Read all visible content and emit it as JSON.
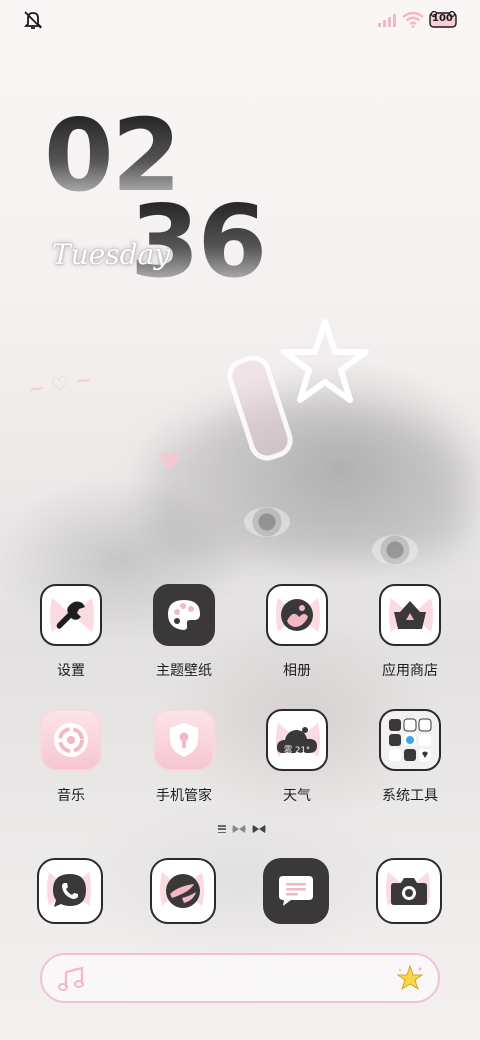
{
  "status_bar": {
    "left_icon": "mute-bell-icon",
    "signal_icon": "signal-bars-icon",
    "wifi_icon": "wifi-icon",
    "battery_level": "100",
    "accent_color": "#f2b8c6"
  },
  "clock": {
    "hour": "02",
    "minute": "36",
    "day": "Tuesday"
  },
  "apps": [
    {
      "label": "设置",
      "icon": "wrench-icon"
    },
    {
      "label": "主题壁纸",
      "icon": "palette-icon"
    },
    {
      "label": "相册",
      "icon": "photo-album-icon"
    },
    {
      "label": "应用商店",
      "icon": "shopping-basket-icon"
    },
    {
      "label": "音乐",
      "icon": "music-disc-icon"
    },
    {
      "label": "手机管家",
      "icon": "shield-icon"
    },
    {
      "label": "天气",
      "icon": "cloud-weather-icon",
      "weather_text": "雾 21°"
    },
    {
      "label": "系统工具",
      "icon": "tools-folder-icon"
    }
  ],
  "dock": [
    {
      "name": "phone",
      "icon": "phone-icon"
    },
    {
      "name": "browser",
      "icon": "browser-globe-icon"
    },
    {
      "name": "messages",
      "icon": "message-bubble-icon"
    },
    {
      "name": "camera",
      "icon": "camera-icon"
    }
  ],
  "page_indicator": {
    "pages": 3,
    "current": 1
  },
  "search_bar": {
    "left_icon": "music-note-icon",
    "right_icon": "sparkle-star-icon"
  },
  "colors": {
    "icon_dark": "#3a3838",
    "pink": "#f2b8c6",
    "pink_light": "#fde4e9"
  }
}
